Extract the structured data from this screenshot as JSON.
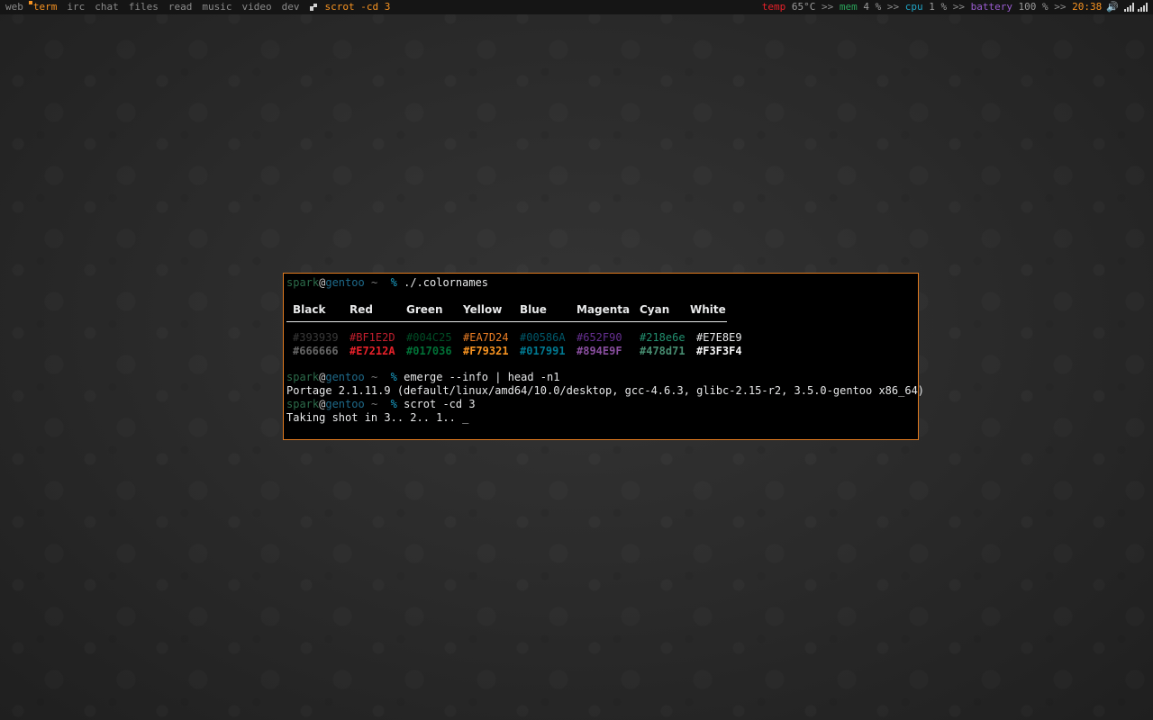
{
  "topbar": {
    "tags": [
      {
        "label": "web",
        "active": false,
        "occupied": false
      },
      {
        "label": "term",
        "active": true,
        "occupied": true
      },
      {
        "label": "irc",
        "active": false,
        "occupied": false
      },
      {
        "label": "chat",
        "active": false,
        "occupied": false
      },
      {
        "label": "files",
        "active": false,
        "occupied": false
      },
      {
        "label": "read",
        "active": false,
        "occupied": false
      },
      {
        "label": "music",
        "active": false,
        "occupied": false
      },
      {
        "label": "video",
        "active": false,
        "occupied": false
      },
      {
        "label": "dev",
        "active": false,
        "occupied": false
      }
    ],
    "window_title": "scrot -cd 3",
    "status": {
      "temp_label": "temp",
      "temp_value": " 65°C ",
      "sep1": ">> ",
      "mem_label": "mem",
      "mem_value": " 4 % ",
      "sep2": ">> ",
      "cpu_label": "cpu",
      "cpu_value": " 1 % ",
      "sep3": ">> ",
      "battery_label": "battery",
      "battery_value": " 100 % ",
      "sep4": ">> ",
      "clock": "20:38",
      "volume_icon": "🔊"
    }
  },
  "terminal": {
    "prompt": {
      "user": "spark",
      "at": "@",
      "host": "gentoo",
      "tilde": " ~ ",
      "pct": " % "
    },
    "lines": {
      "cmd1": "./.colornames",
      "cmd2": "emerge --info | head -n1",
      "output2": "Portage 2.1.11.9 (default/linux/amd64/10.0/desktop, gcc-4.6.3, glibc-2.15-r2, 3.5.0-gentoo x86_64)",
      "cmd3": "scrot -cd 3",
      "output3": "Taking shot in 3.. 2.. 1.. _"
    },
    "color_table": {
      "headers": [
        "Black",
        "Red",
        "Green",
        "Yellow",
        "Blue",
        "Magenta",
        "Cyan",
        "White"
      ],
      "normal": [
        "#393939",
        "#BF1E2D",
        "#004C25",
        "#EA7D24",
        "#00586A",
        "#652F90",
        "#218e6e",
        "#E7E8E9"
      ],
      "bright": [
        "#666666",
        "#E7212A",
        "#017036",
        "#F79321",
        "#017991",
        "#894E9F",
        "#478d71",
        "#F3F3F4"
      ]
    }
  }
}
